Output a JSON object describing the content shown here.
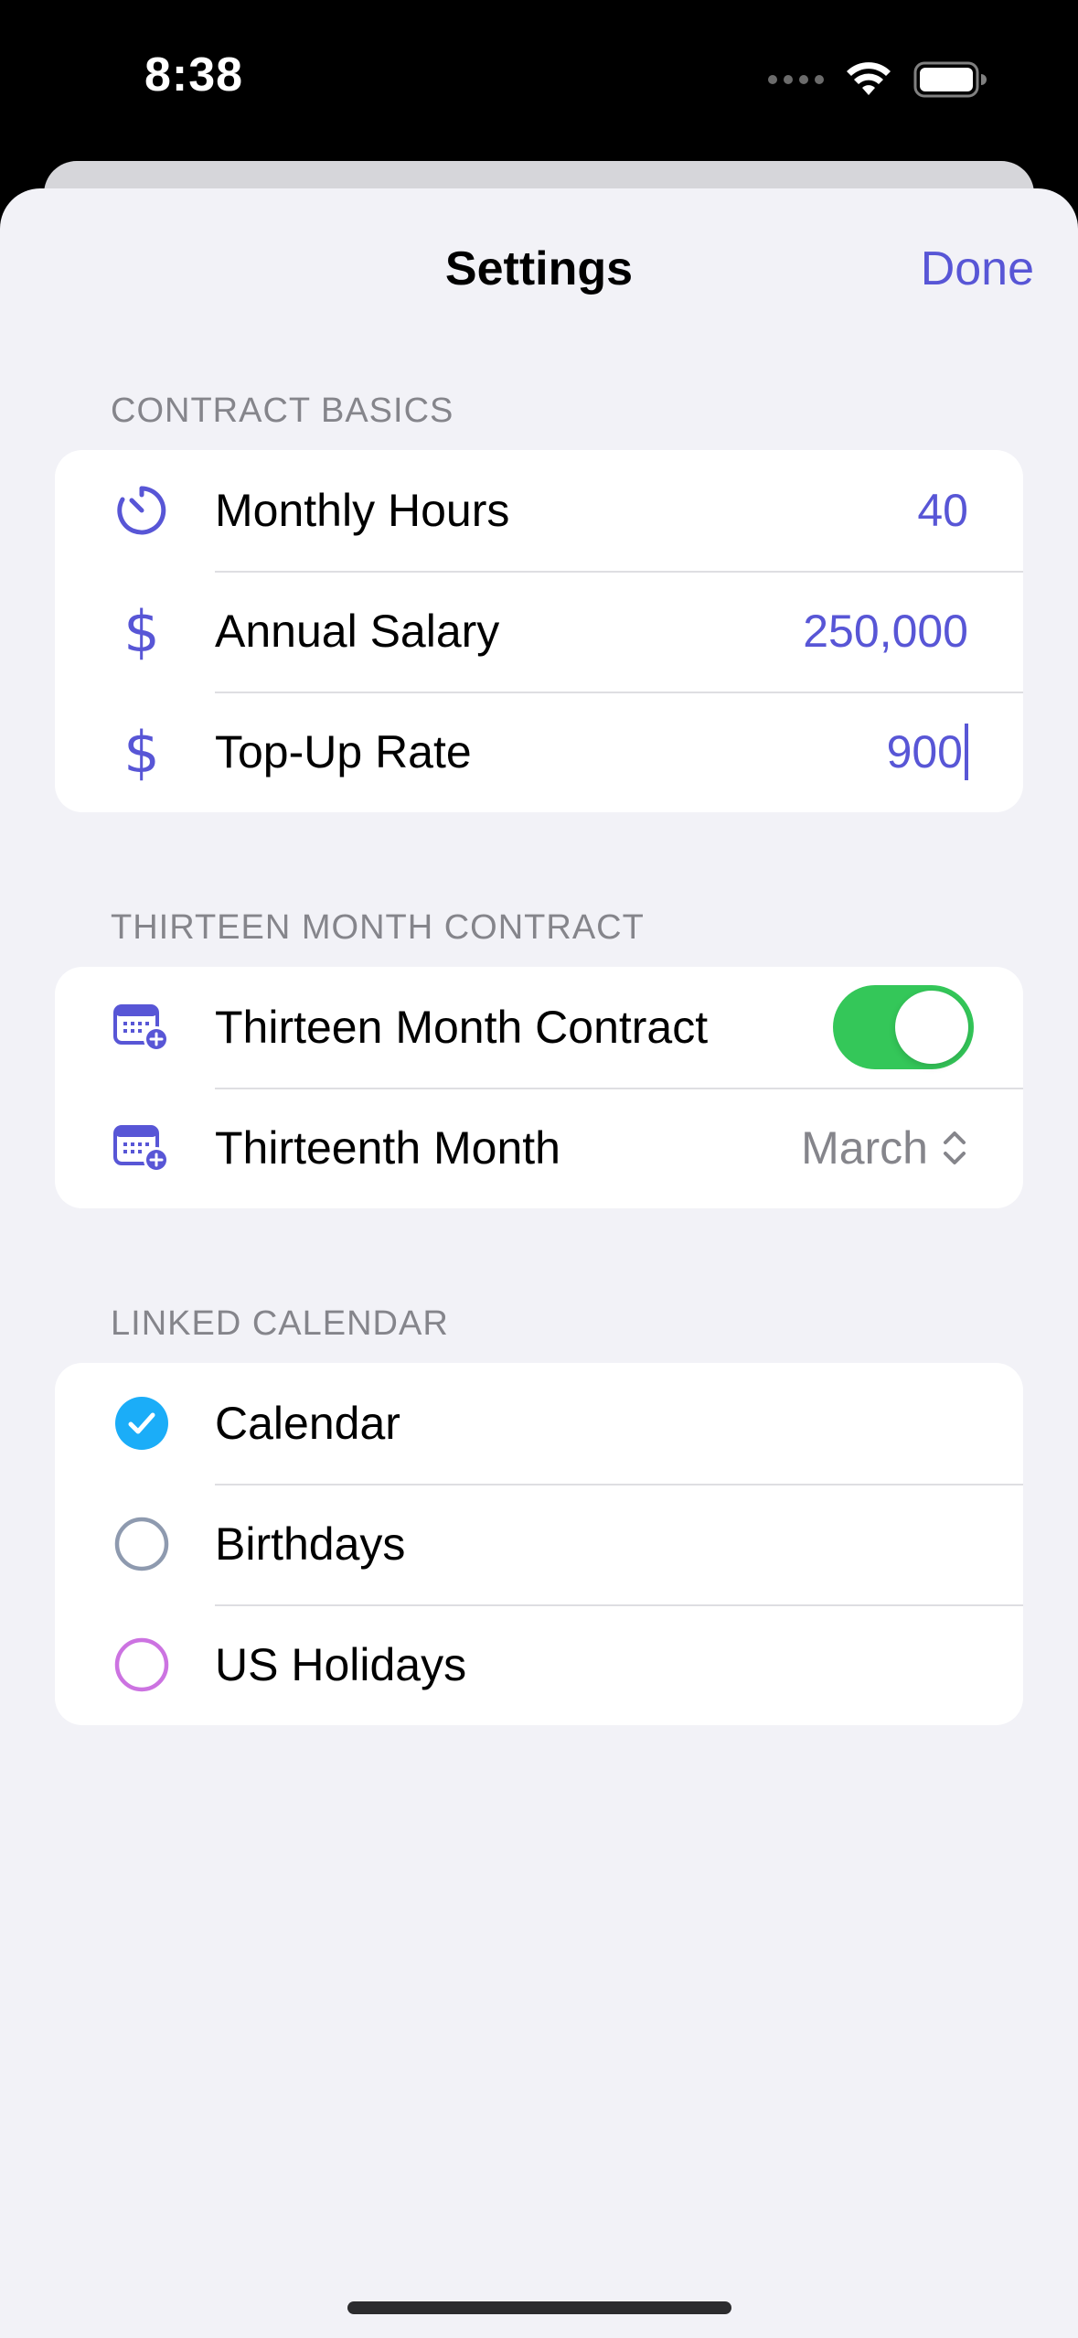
{
  "status_bar": {
    "time": "8:38"
  },
  "nav": {
    "title": "Settings",
    "done_label": "Done"
  },
  "sections": {
    "contract_basics": {
      "header": "CONTRACT BASICS",
      "rows": [
        {
          "label": "Monthly Hours",
          "value": "40",
          "icon": "timer-icon"
        },
        {
          "label": "Annual Salary",
          "value": "250,000",
          "icon": "dollar-icon"
        },
        {
          "label": "Top-Up Rate",
          "value": "900",
          "icon": "dollar-icon"
        }
      ]
    },
    "thirteen_month": {
      "header": "THIRTEEN MONTH CONTRACT",
      "toggle_label": "Thirteen Month Contract",
      "toggle_on": true,
      "month_label": "Thirteenth Month",
      "month_value": "March"
    },
    "linked_calendar": {
      "header": "LINKED CALENDAR",
      "calendars": [
        {
          "label": "Calendar",
          "selected": true,
          "color": "#1badf8"
        },
        {
          "label": "Birthdays",
          "selected": false,
          "color": "#8e9aaf"
        },
        {
          "label": "US Holidays",
          "selected": false,
          "color": "#cc73e1"
        }
      ]
    }
  },
  "colors": {
    "accent": "#5856d6",
    "toggle_on": "#34c759"
  }
}
